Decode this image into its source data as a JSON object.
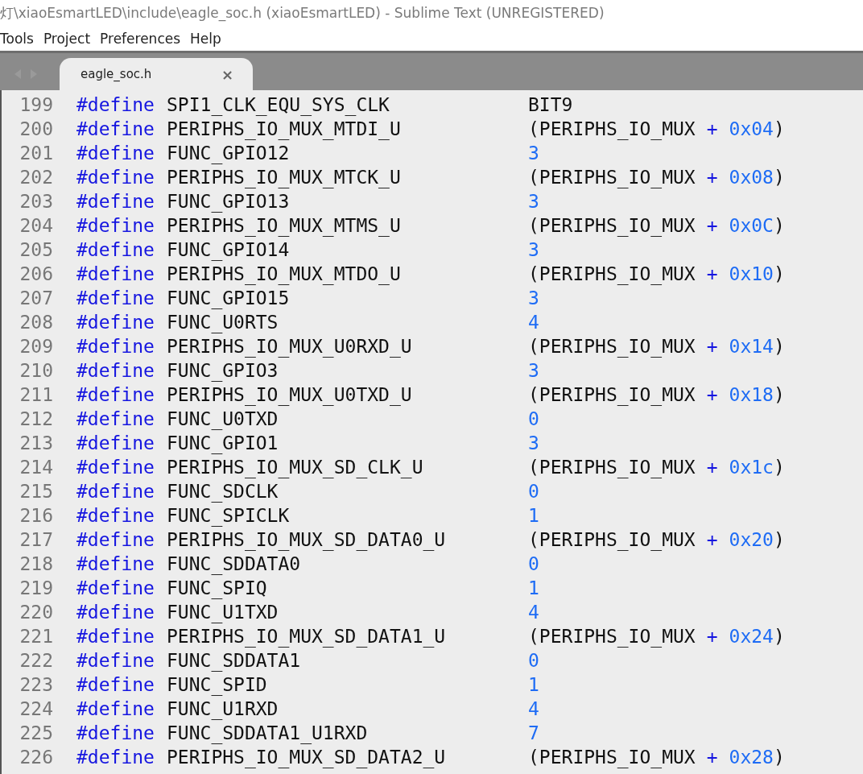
{
  "window": {
    "title": "灯\\xiaoEsmartLED\\include\\eagle_soc.h (xiaoEsmartLED) - Sublime Text (UNREGISTERED)"
  },
  "menu": [
    "Tools",
    "Project",
    "Preferences",
    "Help"
  ],
  "tabs": [
    {
      "label": "eagle_soc.h",
      "close": "×",
      "selected": true
    }
  ],
  "lines": [
    {
      "number": "199",
      "keyword": "#define",
      "name": "SPI1_CLK_EQU_SYS_CLK",
      "value": [
        {
          "kind": "plain",
          "text": "BIT9"
        }
      ]
    },
    {
      "number": "200",
      "keyword": "#define",
      "name": "PERIPHS_IO_MUX_MTDI_U",
      "value": [
        {
          "kind": "plain",
          "text": "(PERIPHS_IO_MUX"
        },
        {
          "kind": "op",
          "text": "+"
        },
        {
          "kind": "number",
          "text": "0x04"
        },
        {
          "kind": "plain",
          "text": ")"
        }
      ]
    },
    {
      "number": "201",
      "keyword": "#define",
      "name": "FUNC_GPIO12",
      "value": [
        {
          "kind": "number",
          "text": "3"
        }
      ]
    },
    {
      "number": "202",
      "keyword": "#define",
      "name": "PERIPHS_IO_MUX_MTCK_U",
      "value": [
        {
          "kind": "plain",
          "text": "(PERIPHS_IO_MUX"
        },
        {
          "kind": "op",
          "text": "+"
        },
        {
          "kind": "number",
          "text": "0x08"
        },
        {
          "kind": "plain",
          "text": ")"
        }
      ]
    },
    {
      "number": "203",
      "keyword": "#define",
      "name": "FUNC_GPIO13",
      "value": [
        {
          "kind": "number",
          "text": "3"
        }
      ]
    },
    {
      "number": "204",
      "keyword": "#define",
      "name": "PERIPHS_IO_MUX_MTMS_U",
      "value": [
        {
          "kind": "plain",
          "text": "(PERIPHS_IO_MUX"
        },
        {
          "kind": "op",
          "text": "+"
        },
        {
          "kind": "number",
          "text": "0x0C"
        },
        {
          "kind": "plain",
          "text": ")"
        }
      ]
    },
    {
      "number": "205",
      "keyword": "#define",
      "name": "FUNC_GPIO14",
      "value": [
        {
          "kind": "number",
          "text": "3"
        }
      ]
    },
    {
      "number": "206",
      "keyword": "#define",
      "name": "PERIPHS_IO_MUX_MTDO_U",
      "value": [
        {
          "kind": "plain",
          "text": "(PERIPHS_IO_MUX"
        },
        {
          "kind": "op",
          "text": "+"
        },
        {
          "kind": "number",
          "text": "0x10"
        },
        {
          "kind": "plain",
          "text": ")"
        }
      ]
    },
    {
      "number": "207",
      "keyword": "#define",
      "name": "FUNC_GPIO15",
      "value": [
        {
          "kind": "number",
          "text": "3"
        }
      ]
    },
    {
      "number": "208",
      "keyword": "#define",
      "name": "FUNC_U0RTS",
      "value": [
        {
          "kind": "number",
          "text": "4"
        }
      ]
    },
    {
      "number": "209",
      "keyword": "#define",
      "name": "PERIPHS_IO_MUX_U0RXD_U",
      "value": [
        {
          "kind": "plain",
          "text": "(PERIPHS_IO_MUX"
        },
        {
          "kind": "op",
          "text": "+"
        },
        {
          "kind": "number",
          "text": "0x14"
        },
        {
          "kind": "plain",
          "text": ")"
        }
      ]
    },
    {
      "number": "210",
      "keyword": "#define",
      "name": "FUNC_GPIO3",
      "value": [
        {
          "kind": "number",
          "text": "3"
        }
      ]
    },
    {
      "number": "211",
      "keyword": "#define",
      "name": "PERIPHS_IO_MUX_U0TXD_U",
      "value": [
        {
          "kind": "plain",
          "text": "(PERIPHS_IO_MUX"
        },
        {
          "kind": "op",
          "text": "+"
        },
        {
          "kind": "number",
          "text": "0x18"
        },
        {
          "kind": "plain",
          "text": ")"
        }
      ]
    },
    {
      "number": "212",
      "keyword": "#define",
      "name": "FUNC_U0TXD",
      "value": [
        {
          "kind": "number",
          "text": "0"
        }
      ]
    },
    {
      "number": "213",
      "keyword": "#define",
      "name": "FUNC_GPIO1",
      "value": [
        {
          "kind": "number",
          "text": "3"
        }
      ]
    },
    {
      "number": "214",
      "keyword": "#define",
      "name": "PERIPHS_IO_MUX_SD_CLK_U",
      "value": [
        {
          "kind": "plain",
          "text": "(PERIPHS_IO_MUX"
        },
        {
          "kind": "op",
          "text": "+"
        },
        {
          "kind": "number",
          "text": "0x1c"
        },
        {
          "kind": "plain",
          "text": ")"
        }
      ]
    },
    {
      "number": "215",
      "keyword": "#define",
      "name": "FUNC_SDCLK",
      "value": [
        {
          "kind": "number",
          "text": "0"
        }
      ]
    },
    {
      "number": "216",
      "keyword": "#define",
      "name": "FUNC_SPICLK",
      "value": [
        {
          "kind": "number",
          "text": "1"
        }
      ]
    },
    {
      "number": "217",
      "keyword": "#define",
      "name": "PERIPHS_IO_MUX_SD_DATA0_U",
      "value": [
        {
          "kind": "plain",
          "text": "(PERIPHS_IO_MUX"
        },
        {
          "kind": "op",
          "text": "+"
        },
        {
          "kind": "number",
          "text": "0x20"
        },
        {
          "kind": "plain",
          "text": ")"
        }
      ]
    },
    {
      "number": "218",
      "keyword": "#define",
      "name": "FUNC_SDDATA0",
      "value": [
        {
          "kind": "number",
          "text": "0"
        }
      ]
    },
    {
      "number": "219",
      "keyword": "#define",
      "name": "FUNC_SPIQ",
      "value": [
        {
          "kind": "number",
          "text": "1"
        }
      ]
    },
    {
      "number": "220",
      "keyword": "#define",
      "name": "FUNC_U1TXD",
      "value": [
        {
          "kind": "number",
          "text": "4"
        }
      ]
    },
    {
      "number": "221",
      "keyword": "#define",
      "name": "PERIPHS_IO_MUX_SD_DATA1_U",
      "value": [
        {
          "kind": "plain",
          "text": "(PERIPHS_IO_MUX"
        },
        {
          "kind": "op",
          "text": "+"
        },
        {
          "kind": "number",
          "text": "0x24"
        },
        {
          "kind": "plain",
          "text": ")"
        }
      ]
    },
    {
      "number": "222",
      "keyword": "#define",
      "name": "FUNC_SDDATA1",
      "value": [
        {
          "kind": "number",
          "text": "0"
        }
      ]
    },
    {
      "number": "223",
      "keyword": "#define",
      "name": "FUNC_SPID",
      "value": [
        {
          "kind": "number",
          "text": "1"
        }
      ]
    },
    {
      "number": "224",
      "keyword": "#define",
      "name": "FUNC_U1RXD",
      "value": [
        {
          "kind": "number",
          "text": "4"
        }
      ]
    },
    {
      "number": "225",
      "keyword": "#define",
      "name": "FUNC_SDDATA1_U1RXD",
      "value": [
        {
          "kind": "number",
          "text": "7"
        }
      ]
    },
    {
      "number": "226",
      "keyword": "#define",
      "name": "PERIPHS_IO_MUX_SD_DATA2_U",
      "value": [
        {
          "kind": "plain",
          "text": "(PERIPHS_IO_MUX"
        },
        {
          "kind": "op",
          "text": "+"
        },
        {
          "kind": "number",
          "text": "0x28"
        },
        {
          "kind": "plain",
          "text": ")"
        }
      ]
    }
  ]
}
